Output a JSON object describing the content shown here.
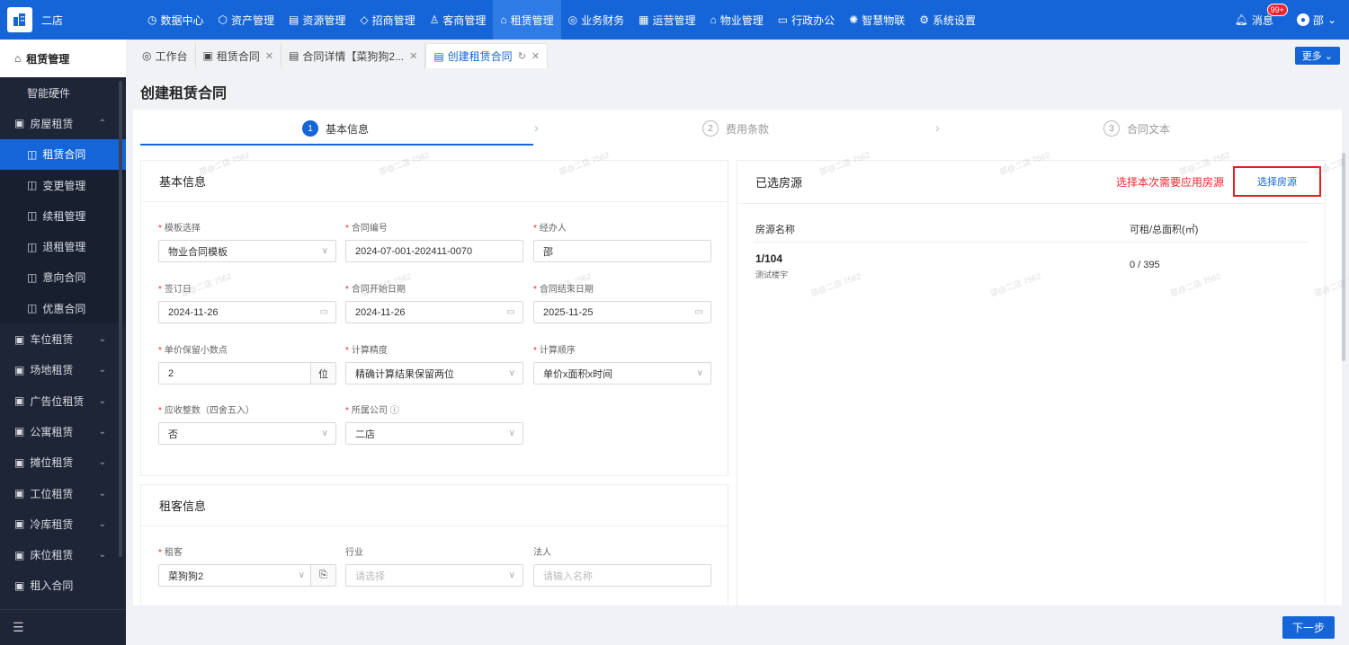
{
  "store_name": "二店",
  "nav": [
    {
      "icon": "dashboard-icon",
      "glyph": "◷",
      "label": "数据中心"
    },
    {
      "icon": "asset-icon",
      "glyph": "⬡",
      "label": "资产管理"
    },
    {
      "icon": "resource-icon",
      "glyph": "▤",
      "label": "资源管理"
    },
    {
      "icon": "invest-icon",
      "glyph": "◇",
      "label": "招商管理"
    },
    {
      "icon": "customer-icon",
      "glyph": "♙",
      "label": "客商管理"
    },
    {
      "icon": "home-icon",
      "glyph": "⌂",
      "label": "租赁管理"
    },
    {
      "icon": "finance-icon",
      "glyph": "◎",
      "label": "业务财务"
    },
    {
      "icon": "ops-icon",
      "glyph": "▦",
      "label": "运营管理"
    },
    {
      "icon": "property-icon",
      "glyph": "⌂",
      "label": "物业管理"
    },
    {
      "icon": "office-icon",
      "glyph": "▭",
      "label": "行政办公"
    },
    {
      "icon": "iot-icon",
      "glyph": "✺",
      "label": "智慧物联"
    },
    {
      "icon": "settings-icon",
      "glyph": "⚙",
      "label": "系统设置"
    }
  ],
  "messages": {
    "label": "消息",
    "badge": "99+"
  },
  "user": {
    "name": "邵"
  },
  "sidebar": {
    "title": "租赁管理",
    "items": [
      {
        "label": "智能硬件",
        "type": "sub2"
      },
      {
        "label": "房屋租赁",
        "type": "group",
        "chev": "⌃"
      },
      {
        "label": "租赁合同",
        "type": "sub",
        "active": true
      },
      {
        "label": "变更管理",
        "type": "sub"
      },
      {
        "label": "续租管理",
        "type": "sub"
      },
      {
        "label": "退租管理",
        "type": "sub"
      },
      {
        "label": "意向合同",
        "type": "sub"
      },
      {
        "label": "优惠合同",
        "type": "sub"
      },
      {
        "label": "车位租赁",
        "type": "group",
        "chev": "⌄"
      },
      {
        "label": "场地租赁",
        "type": "group",
        "chev": "⌄"
      },
      {
        "label": "广告位租赁",
        "type": "group",
        "chev": "⌄"
      },
      {
        "label": "公寓租赁",
        "type": "group",
        "chev": "⌄"
      },
      {
        "label": "摊位租赁",
        "type": "group",
        "chev": "⌄"
      },
      {
        "label": "工位租赁",
        "type": "group",
        "chev": "⌄"
      },
      {
        "label": "冷库租赁",
        "type": "group",
        "chev": "⌄"
      },
      {
        "label": "床位租赁",
        "type": "group",
        "chev": "⌄"
      },
      {
        "label": "租入合同",
        "type": "group",
        "chev": ""
      }
    ]
  },
  "tabs": [
    {
      "label": "工作台",
      "closable": false
    },
    {
      "label": "租赁合同",
      "closable": true
    },
    {
      "label": "合同详情【菜狗狗2...",
      "closable": true
    },
    {
      "label": "创建租赁合同",
      "closable": true,
      "active": true
    }
  ],
  "more_label": "更多",
  "page_title": "创建租赁合同",
  "steps": [
    {
      "num": "1",
      "label": "基本信息"
    },
    {
      "num": "2",
      "label": "费用条款"
    },
    {
      "num": "3",
      "label": "合同文本"
    }
  ],
  "basic": {
    "title": "基本信息",
    "template": {
      "label": "模板选择",
      "value": "物业合同模板"
    },
    "contract_no": {
      "label": "合同编号",
      "value": "2024-07-001-202411-0070"
    },
    "handler": {
      "label": "经办人",
      "value": "邵"
    },
    "sign_date": {
      "label": "签订日",
      "value": "2024-11-26"
    },
    "start_date": {
      "label": "合同开始日期",
      "value": "2024-11-26"
    },
    "end_date": {
      "label": "合同结束日期",
      "value": "2025-11-25"
    },
    "decimals": {
      "label": "单价保留小数点",
      "value": "2",
      "unit": "位"
    },
    "precision": {
      "label": "计算精度",
      "value": "精确计算结果保留两位"
    },
    "order": {
      "label": "计算顺序",
      "value": "单价x面积x时间"
    },
    "rounding": {
      "label": "应收整数（四舍五入）",
      "value": "否"
    },
    "company": {
      "label": "所属公司",
      "value": "二店"
    }
  },
  "tenant": {
    "title": "租客信息",
    "tenant": {
      "label": "租客",
      "value": "菜狗狗2"
    },
    "industry": {
      "label": "行业",
      "placeholder": "请选择"
    },
    "legal": {
      "label": "法人",
      "placeholder": "请输入名称"
    }
  },
  "rooms": {
    "title": "已选房源",
    "hint": "选择本次需要应用房源",
    "button": "选择房源",
    "col_name": "房源名称",
    "col_area": "可租/总面积(㎡)",
    "rows": [
      {
        "name": "1/104",
        "building": "测试楼宇",
        "area": "0 / 395"
      }
    ]
  },
  "next_label": "下一步",
  "watermark": "邵@二店 7562"
}
